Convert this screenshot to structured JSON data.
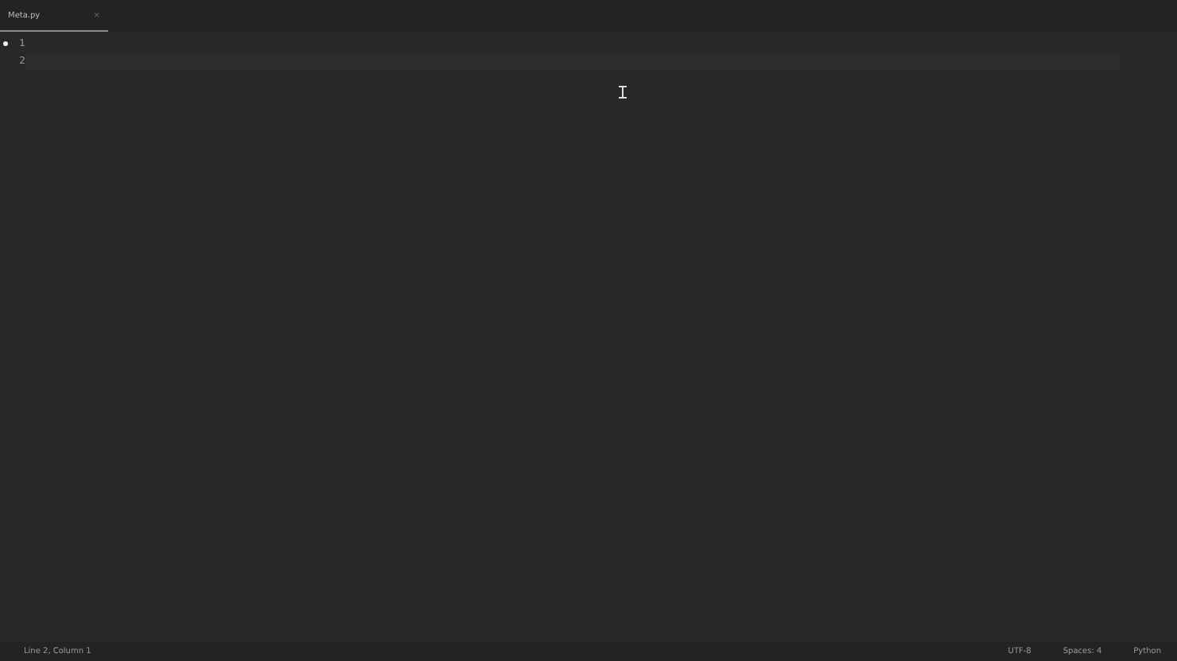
{
  "tabs": [
    {
      "label": "Meta.py",
      "selected": true,
      "close": "×"
    }
  ],
  "editor": {
    "lines": [
      {
        "number": "1",
        "marker": true,
        "current": false
      },
      {
        "number": "2",
        "marker": false,
        "current": true
      }
    ]
  },
  "status_bar": {
    "left": "Line 2, Column 1",
    "right": [
      "UTF-8",
      "Spaces: 4",
      "Python"
    ]
  }
}
